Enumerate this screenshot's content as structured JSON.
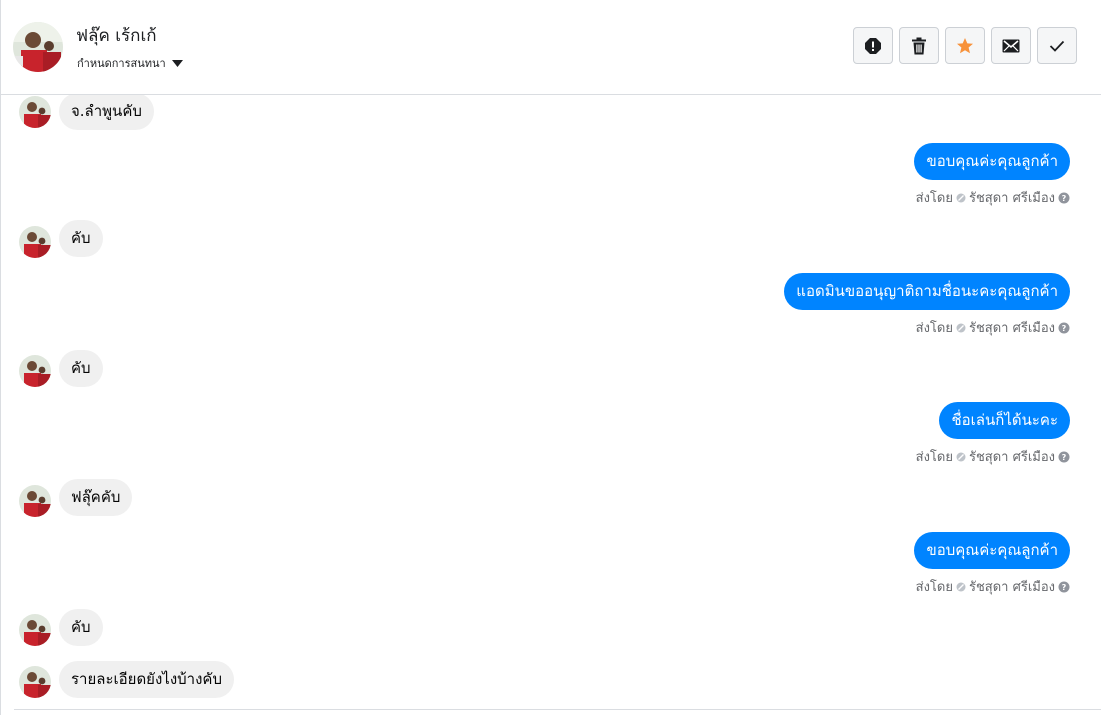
{
  "header": {
    "contact_name": "ฟลุ๊ค เร้กเก้",
    "conversation_settings_label": "กำหนดการสนทนา",
    "actions": [
      {
        "icon": "exclamation-icon"
      },
      {
        "icon": "trash-icon"
      },
      {
        "icon": "star-icon",
        "color": "#f7923b"
      },
      {
        "icon": "envelope-icon"
      },
      {
        "icon": "check-icon"
      }
    ]
  },
  "thread": {
    "sent_by_label": "ส่งโดย",
    "messages": [
      {
        "direction": "in",
        "text": "จ.ลำพูนคับ"
      },
      {
        "direction": "out",
        "text": "ขอบคุณค่ะคุณลูกค้า",
        "sender": "รัชสุดา ศรีเมือง"
      },
      {
        "direction": "in",
        "text": "คับ"
      },
      {
        "direction": "out",
        "text": "แอดมินขออนุญาติถามชื่อนะคะคุณลูกค้า",
        "sender": "รัชสุดา ศรีเมือง"
      },
      {
        "direction": "in",
        "text": "คับ"
      },
      {
        "direction": "out",
        "text": "ชื่อเล่นก็ได้นะคะ",
        "sender": "รัชสุดา ศรีเมือง"
      },
      {
        "direction": "in",
        "text": "ฟลุ๊คคับ"
      },
      {
        "direction": "out",
        "text": "ขอบคุณค่ะคุณลูกค้า",
        "sender": "รัชสุดา ศรีเมือง"
      },
      {
        "direction": "in",
        "text": "คับ"
      },
      {
        "direction": "in",
        "text": "รายละเอียดยังไงบ้างคับ"
      }
    ]
  },
  "colors": {
    "outgoing_bubble": "#0084ff",
    "incoming_bubble": "#f0f0f0",
    "star": "#f7923b"
  }
}
